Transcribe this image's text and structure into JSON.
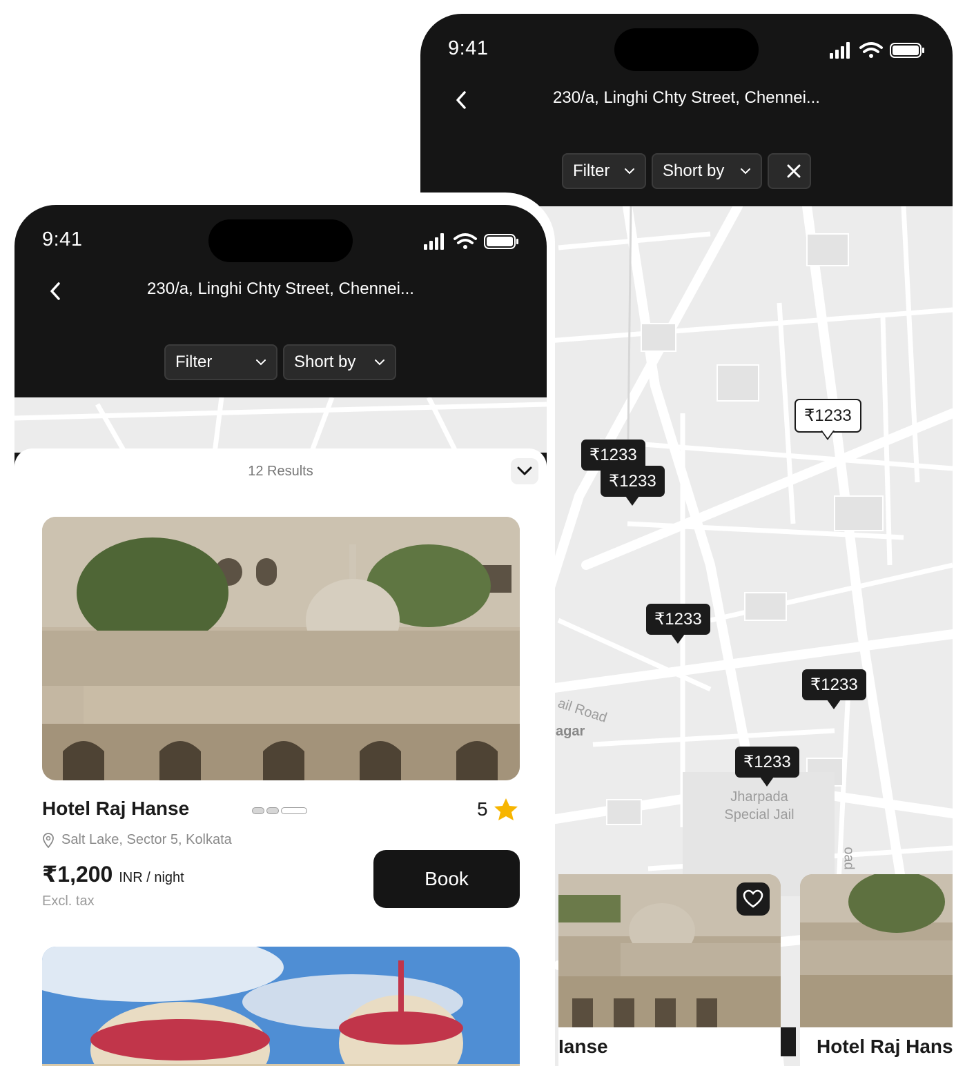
{
  "status": {
    "time": "9:41"
  },
  "header": {
    "address": "230/a, Linghi Chty Street, Chennei..."
  },
  "chips": {
    "filter": "Filter",
    "sort": "Short by"
  },
  "map": {
    "pins": [
      "₹1233",
      "₹1233",
      "₹1233",
      "₹1233",
      "₹1233",
      "₹1233"
    ],
    "labels": {
      "road": "ail Road",
      "area": "agar",
      "jail": "Jharpada Special Jail",
      "side_road": "oad"
    }
  },
  "sheet": {
    "results": "12 Results",
    "hotel": {
      "name": "Hotel Raj Hanse",
      "rating": "5",
      "location": "Salt Lake, Sector 5, Kolkata",
      "price": "₹1,200",
      "unit": "INR / night",
      "tax_note": "Excl. tax",
      "book_label": "Book"
    }
  },
  "map_cards": {
    "first_name_partial": "Ianse",
    "second_name_partial": "Hotel Raj Hans"
  },
  "colors": {
    "dark": "#151515",
    "chip_bg": "#2a2a2a",
    "map_bg": "#ececec",
    "star": "#f7b500"
  }
}
